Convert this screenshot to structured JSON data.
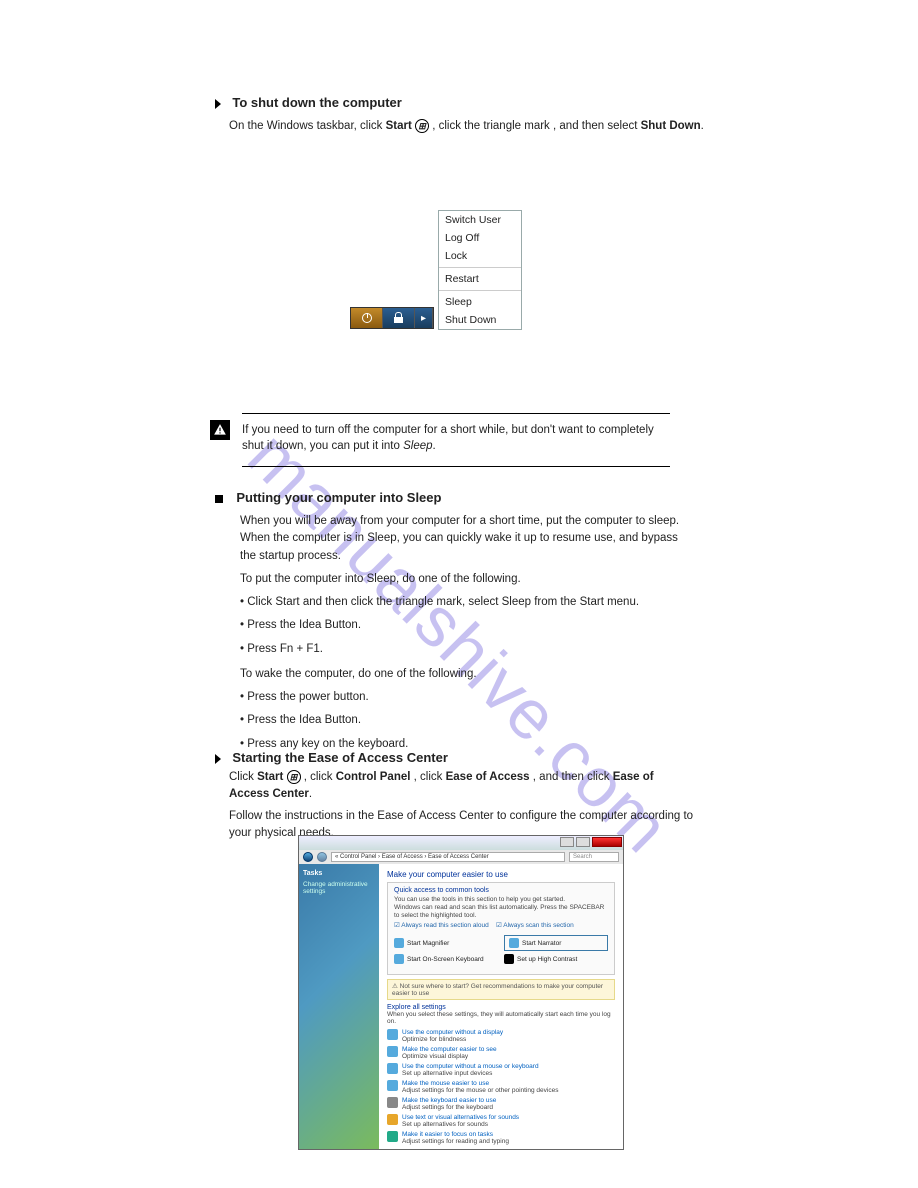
{
  "watermark": "manualshive.com",
  "shutdown": {
    "heading": "To shut down the computer",
    "intro_pre": "On the Windows taskbar, click ",
    "intro_bold1": "Start ",
    "intro_mid": ", click the triangle mark",
    "intro_post": ", and then select ",
    "intro_bold2": "Shut Down",
    "intro_end": ".",
    "menu": {
      "items": [
        "Switch User",
        "Log Off",
        "Lock",
        "Restart",
        "Sleep",
        "Shut Down"
      ]
    }
  },
  "caution": {
    "text": "If you need to turn off the computer for a short while, but don't want to completely shut it down, you can put it into ",
    "italic": "Sleep",
    "tail": "."
  },
  "sleep": {
    "heading": "Putting your computer into Sleep",
    "p1": "When you will be away from your computer for a short time, put the computer to sleep. When the computer is in Sleep, you can quickly wake it up to resume use, and bypass the startup process.",
    "list_head": "To put the computer into Sleep, do one of the following.",
    "items": [
      "Click Start and then click the triangle mark, select Sleep from the Start menu.",
      "Press the Idea Button.",
      "Press Fn + F1."
    ],
    "wake_label": "To wake the computer, do one of the following.",
    "wake_items": [
      "Press the power button.",
      "Press the Idea Button.",
      "Press any key on the keyboard."
    ]
  },
  "ease": {
    "heading": "Starting the Ease of Access Center",
    "p1_pre": "Click ",
    "p1_bold1": "Start",
    "p1_mid": ", click ",
    "p1_bold2": "Control Panel",
    "p1_mid2": ", click ",
    "p1_bold3": "Ease of Access",
    "p1_mid3": ", and then click ",
    "p1_bold4": "Ease of Access Center",
    "p1_end": ".",
    "p2": "Follow the instructions in the Ease of Access Center to configure the computer according to your physical needs."
  },
  "eoa_window": {
    "path": "« Control Panel  ›  Ease of Access  ›  Ease of Access Center",
    "search_ph": "Search",
    "sidebar": {
      "tasks": "Tasks",
      "link": "Change administrative settings"
    },
    "title": "Make your computer easier to use",
    "quick": {
      "title": "Quick access to common tools",
      "desc1": "You can use the tools in this section to help you get started.",
      "desc2": "Windows can read and scan this list automatically. Press the SPACEBAR to select the highlighted tool.",
      "chk1": "Always read this section aloud",
      "chk2": "Always scan this section",
      "tools": [
        "Start Magnifier",
        "Start Narrator",
        "Start On-Screen Keyboard",
        "Set up High Contrast"
      ]
    },
    "yellow": "Not sure where to start? Get recommendations to make your computer easier to use",
    "explore": {
      "title": "Explore all settings",
      "sub": "When you select these settings, they will automatically start each time you log on.",
      "rows": [
        {
          "link": "Use the computer without a display",
          "sub": "Optimize for blindness"
        },
        {
          "link": "Make the computer easier to see",
          "sub": "Optimize visual display"
        },
        {
          "link": "Use the computer without a mouse or keyboard",
          "sub": "Set up alternative input devices"
        },
        {
          "link": "Make the mouse easier to use",
          "sub": "Adjust settings for the mouse or other pointing devices"
        },
        {
          "link": "Make the keyboard easier to use",
          "sub": "Adjust settings for the keyboard"
        },
        {
          "link": "Use text or visual alternatives for sounds",
          "sub": "Set up alternatives for sounds"
        },
        {
          "link": "Make it easier to focus on tasks",
          "sub": "Adjust settings for reading and typing"
        }
      ]
    }
  }
}
